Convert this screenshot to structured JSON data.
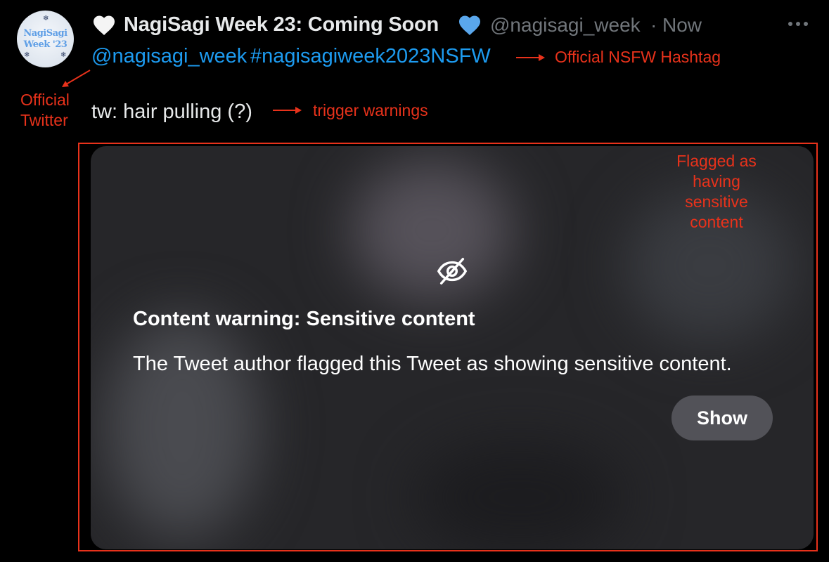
{
  "tweet": {
    "display_name": "NagiSagi Week 23: Coming Soon",
    "handle": "@nagisagi_week",
    "separator": "·",
    "timestamp": "Now",
    "avatar_text_line1": "NagiSagi",
    "avatar_text_line2": "Week '23",
    "mention": "@nagisagi_week",
    "hashtag": "#nagisagiweek2023NSFW",
    "body_text": "tw: hair pulling (?)"
  },
  "media": {
    "warning_title": "Content warning: Sensitive content",
    "warning_description": "The Tweet author flagged this Tweet as showing sensitive content.",
    "show_button_label": "Show"
  },
  "annotations": {
    "hashtag_note": "Official NSFW Hashtag",
    "trigger_note": "trigger warnings",
    "official_note": "Official\nTwitter",
    "flagged_note": "Flagged as having\nsensitive content",
    "color": "#e8321b"
  },
  "icons": {
    "white_heart": "white-heart-icon",
    "blue_heart": "blue-heart-icon",
    "more": "more-horizontal-icon",
    "eye_off": "eye-off-icon"
  },
  "colors": {
    "background": "#000000",
    "link": "#1d9bf0",
    "secondary_text": "#71767b",
    "annotation": "#e8321b"
  }
}
